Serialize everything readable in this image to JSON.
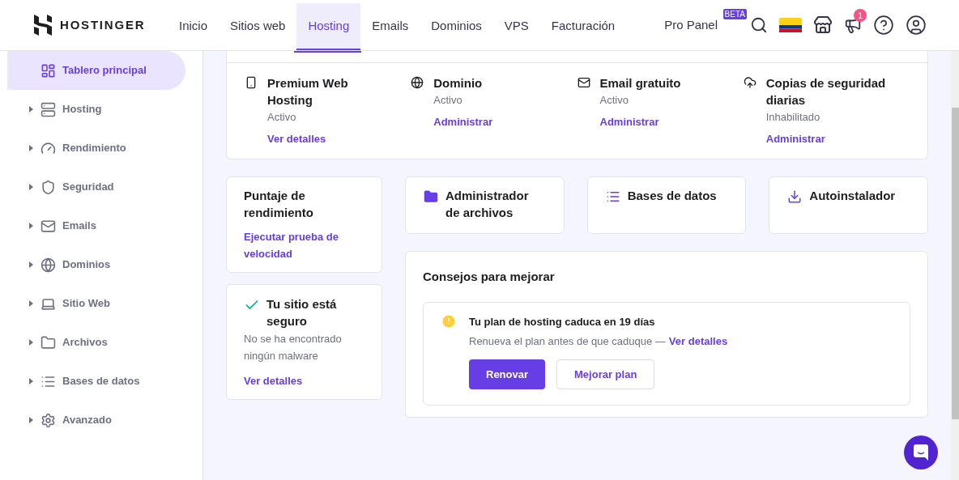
{
  "header": {
    "brand": "HOSTINGER",
    "nav": [
      {
        "label": "Inicio",
        "selected": false
      },
      {
        "label": "Sitios web",
        "selected": false
      },
      {
        "label": "Hosting",
        "selected": true
      },
      {
        "label": "Emails",
        "selected": false
      },
      {
        "label": "Dominios",
        "selected": false
      },
      {
        "label": "VPS",
        "selected": false
      },
      {
        "label": "Facturación",
        "selected": false
      }
    ],
    "pro_panel": {
      "label": "Pro Panel",
      "badge": "BETA"
    },
    "notification_count": "1"
  },
  "sidebar": {
    "items": [
      {
        "label": "Tablero principal",
        "selected": true,
        "expandable": false
      },
      {
        "label": "Hosting",
        "selected": false,
        "expandable": true
      },
      {
        "label": "Rendimiento",
        "selected": false,
        "expandable": true
      },
      {
        "label": "Seguridad",
        "selected": false,
        "expandable": true
      },
      {
        "label": "Emails",
        "selected": false,
        "expandable": true
      },
      {
        "label": "Dominios",
        "selected": false,
        "expandable": true
      },
      {
        "label": "Sitio Web",
        "selected": false,
        "expandable": true
      },
      {
        "label": "Archivos",
        "selected": false,
        "expandable": true
      },
      {
        "label": "Bases de datos",
        "selected": false,
        "expandable": true
      },
      {
        "label": "Avanzado",
        "selected": false,
        "expandable": true
      }
    ]
  },
  "services": [
    {
      "title": "Premium Web Hosting",
      "status": "Activo",
      "link": "Ver detalles"
    },
    {
      "title": "Dominio",
      "status": "Activo",
      "link": "Administrar"
    },
    {
      "title": "Email gratuito",
      "status": "Activo",
      "link": "Administrar"
    },
    {
      "title": "Copias de seguridad diarias",
      "status": "Inhabilitado",
      "link": "Administrar"
    }
  ],
  "performance": {
    "title": "Puntaje de rendimiento",
    "link": "Ejecutar prueba de velocidad"
  },
  "security": {
    "title": "Tu sitio está seguro",
    "text": "No se ha encontrado ningún malware",
    "link": "Ver detalles"
  },
  "tools": [
    {
      "label": "Administrador de archivos"
    },
    {
      "label": "Bases de datos"
    },
    {
      "label": "Autoinstalador"
    }
  ],
  "tips": {
    "title": "Consejos para mejorar",
    "alert": {
      "title": "Tu plan de hosting caduca en 19 días",
      "text": "Renueva el plan antes de que caduque —",
      "link": "Ver detalles"
    },
    "buttons": [
      {
        "label": "Renovar",
        "kind": "primary"
      },
      {
        "label": "Mejorar plan",
        "kind": "secondary"
      }
    ]
  }
}
